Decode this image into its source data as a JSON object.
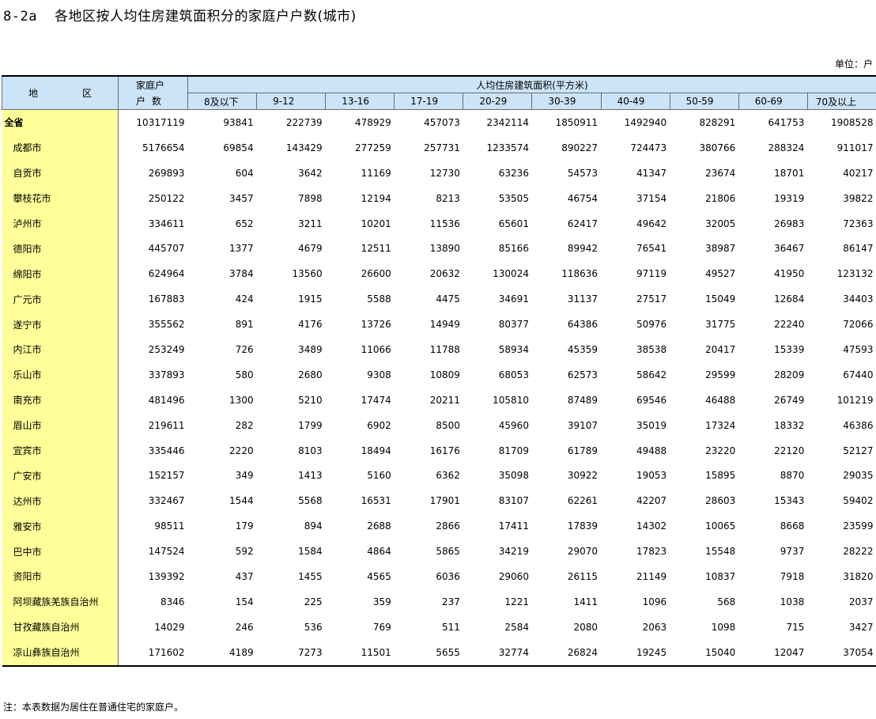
{
  "document": {
    "table_code": "8-2a",
    "title": "各地区按人均住房建筑面积分的家庭户户数(城市)",
    "unit": "单位：户",
    "note": "注：本表数据为居住在普通住宅的家庭户。"
  },
  "headers": {
    "region": "地　区",
    "total_line1": "家庭户",
    "total_line2": "户数",
    "group": "人均住房建筑面积(平方米)",
    "bins": [
      "8及以下",
      "9-12",
      "13-16",
      "17-19",
      "20-29",
      "30-39",
      "40-49",
      "50-59",
      "60-69",
      "70及以上"
    ]
  },
  "rows": [
    {
      "region": "全省",
      "total": "10317119",
      "values": [
        "93841",
        "222739",
        "478929",
        "457073",
        "2342114",
        "1850911",
        "1492940",
        "828291",
        "641753",
        "1908528"
      ]
    },
    {
      "region": "成都市",
      "total": "5176654",
      "values": [
        "69854",
        "143429",
        "277259",
        "257731",
        "1233574",
        "890227",
        "724473",
        "380766",
        "288324",
        "911017"
      ]
    },
    {
      "region": "自贡市",
      "total": "269893",
      "values": [
        "604",
        "3642",
        "11169",
        "12730",
        "63236",
        "54573",
        "41347",
        "23674",
        "18701",
        "40217"
      ]
    },
    {
      "region": "攀枝花市",
      "total": "250122",
      "values": [
        "3457",
        "7898",
        "12194",
        "8213",
        "53505",
        "46754",
        "37154",
        "21806",
        "19319",
        "39822"
      ]
    },
    {
      "region": "泸州市",
      "total": "334611",
      "values": [
        "652",
        "3211",
        "10201",
        "11536",
        "65601",
        "62417",
        "49642",
        "32005",
        "26983",
        "72363"
      ]
    },
    {
      "region": "德阳市",
      "total": "445707",
      "values": [
        "1377",
        "4679",
        "12511",
        "13890",
        "85166",
        "89942",
        "76541",
        "38987",
        "36467",
        "86147"
      ]
    },
    {
      "region": "绵阳市",
      "total": "624964",
      "values": [
        "3784",
        "13560",
        "26600",
        "20632",
        "130024",
        "118636",
        "97119",
        "49527",
        "41950",
        "123132"
      ]
    },
    {
      "region": "广元市",
      "total": "167883",
      "values": [
        "424",
        "1915",
        "5588",
        "4475",
        "34691",
        "31137",
        "27517",
        "15049",
        "12684",
        "34403"
      ]
    },
    {
      "region": "遂宁市",
      "total": "355562",
      "values": [
        "891",
        "4176",
        "13726",
        "14949",
        "80377",
        "64386",
        "50976",
        "31775",
        "22240",
        "72066"
      ]
    },
    {
      "region": "内江市",
      "total": "253249",
      "values": [
        "726",
        "3489",
        "11066",
        "11788",
        "58934",
        "45359",
        "38538",
        "20417",
        "15339",
        "47593"
      ]
    },
    {
      "region": "乐山市",
      "total": "337893",
      "values": [
        "580",
        "2680",
        "9308",
        "10809",
        "68053",
        "62573",
        "58642",
        "29599",
        "28209",
        "67440"
      ]
    },
    {
      "region": "南充市",
      "total": "481496",
      "values": [
        "1300",
        "5210",
        "17474",
        "20211",
        "105810",
        "87489",
        "69546",
        "46488",
        "26749",
        "101219"
      ]
    },
    {
      "region": "眉山市",
      "total": "219611",
      "values": [
        "282",
        "1799",
        "6902",
        "8500",
        "45960",
        "39107",
        "35019",
        "17324",
        "18332",
        "46386"
      ]
    },
    {
      "region": "宜宾市",
      "total": "335446",
      "values": [
        "2220",
        "8103",
        "18494",
        "16176",
        "81709",
        "61789",
        "49488",
        "23220",
        "22120",
        "52127"
      ]
    },
    {
      "region": "广安市",
      "total": "152157",
      "values": [
        "349",
        "1413",
        "5160",
        "6362",
        "35098",
        "30922",
        "19053",
        "15895",
        "8870",
        "29035"
      ]
    },
    {
      "region": "达州市",
      "total": "332467",
      "values": [
        "1544",
        "5568",
        "16531",
        "17901",
        "83107",
        "62261",
        "42207",
        "28603",
        "15343",
        "59402"
      ]
    },
    {
      "region": "雅安市",
      "total": "98511",
      "values": [
        "179",
        "894",
        "2688",
        "2866",
        "17411",
        "17839",
        "14302",
        "10065",
        "8668",
        "23599"
      ]
    },
    {
      "region": "巴中市",
      "total": "147524",
      "values": [
        "592",
        "1584",
        "4864",
        "5865",
        "34219",
        "29070",
        "17823",
        "15548",
        "9737",
        "28222"
      ]
    },
    {
      "region": "资阳市",
      "total": "139392",
      "values": [
        "437",
        "1455",
        "4565",
        "6036",
        "29060",
        "26115",
        "21149",
        "10837",
        "7918",
        "31820"
      ]
    },
    {
      "region": "阿坝藏族羌族自治州",
      "total": "8346",
      "values": [
        "154",
        "225",
        "359",
        "237",
        "1221",
        "1411",
        "1096",
        "568",
        "1038",
        "2037"
      ]
    },
    {
      "region": "甘孜藏族自治州",
      "total": "14029",
      "values": [
        "246",
        "536",
        "769",
        "511",
        "2584",
        "2080",
        "2063",
        "1098",
        "715",
        "3427"
      ]
    },
    {
      "region": "凉山彝族自治州",
      "total": "171602",
      "values": [
        "4189",
        "7273",
        "11501",
        "5655",
        "32774",
        "26824",
        "19245",
        "15040",
        "12047",
        "37054"
      ]
    }
  ]
}
